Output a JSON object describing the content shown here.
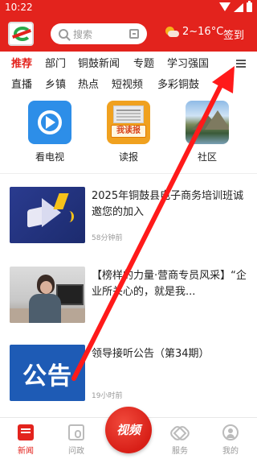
{
  "status": {
    "time": "10:22"
  },
  "header": {
    "search_placeholder": "搜索",
    "weather": "2~16°C",
    "signin": "签到"
  },
  "tabs": {
    "row1": [
      "推荐",
      "部门",
      "铜鼓新闻",
      "专题",
      "学习强国"
    ],
    "row2": [
      "直播",
      "乡镇",
      "热点",
      "短视频",
      "多彩铜鼓"
    ],
    "active": "推荐"
  },
  "apps": [
    {
      "label": "看电视",
      "icon": "play-tv-icon"
    },
    {
      "label": "读报",
      "icon": "newspaper-icon",
      "badge_text": "我读报"
    },
    {
      "label": "社区",
      "icon": "landscape-icon"
    }
  ],
  "news": [
    {
      "title": "2025年铜鼓县电子商务培训班诚邀您的加入",
      "meta": "58分钟前",
      "thumb": "megaphone"
    },
    {
      "title": "【榜样的力量·营商专员风采】“企业所关心的，就是我...",
      "meta": "",
      "thumb": "photo"
    },
    {
      "title": "领导接听公告（第34期）",
      "meta": "19小时前",
      "thumb": "notice",
      "thumb_text": "公告"
    }
  ],
  "bottom_nav": {
    "items": [
      "新闻",
      "问政",
      "视频",
      "服务",
      "我的"
    ],
    "active": "新闻"
  },
  "colors": {
    "brand_red": "#e3231d",
    "annotation_arrow": "#ff1a1a"
  }
}
